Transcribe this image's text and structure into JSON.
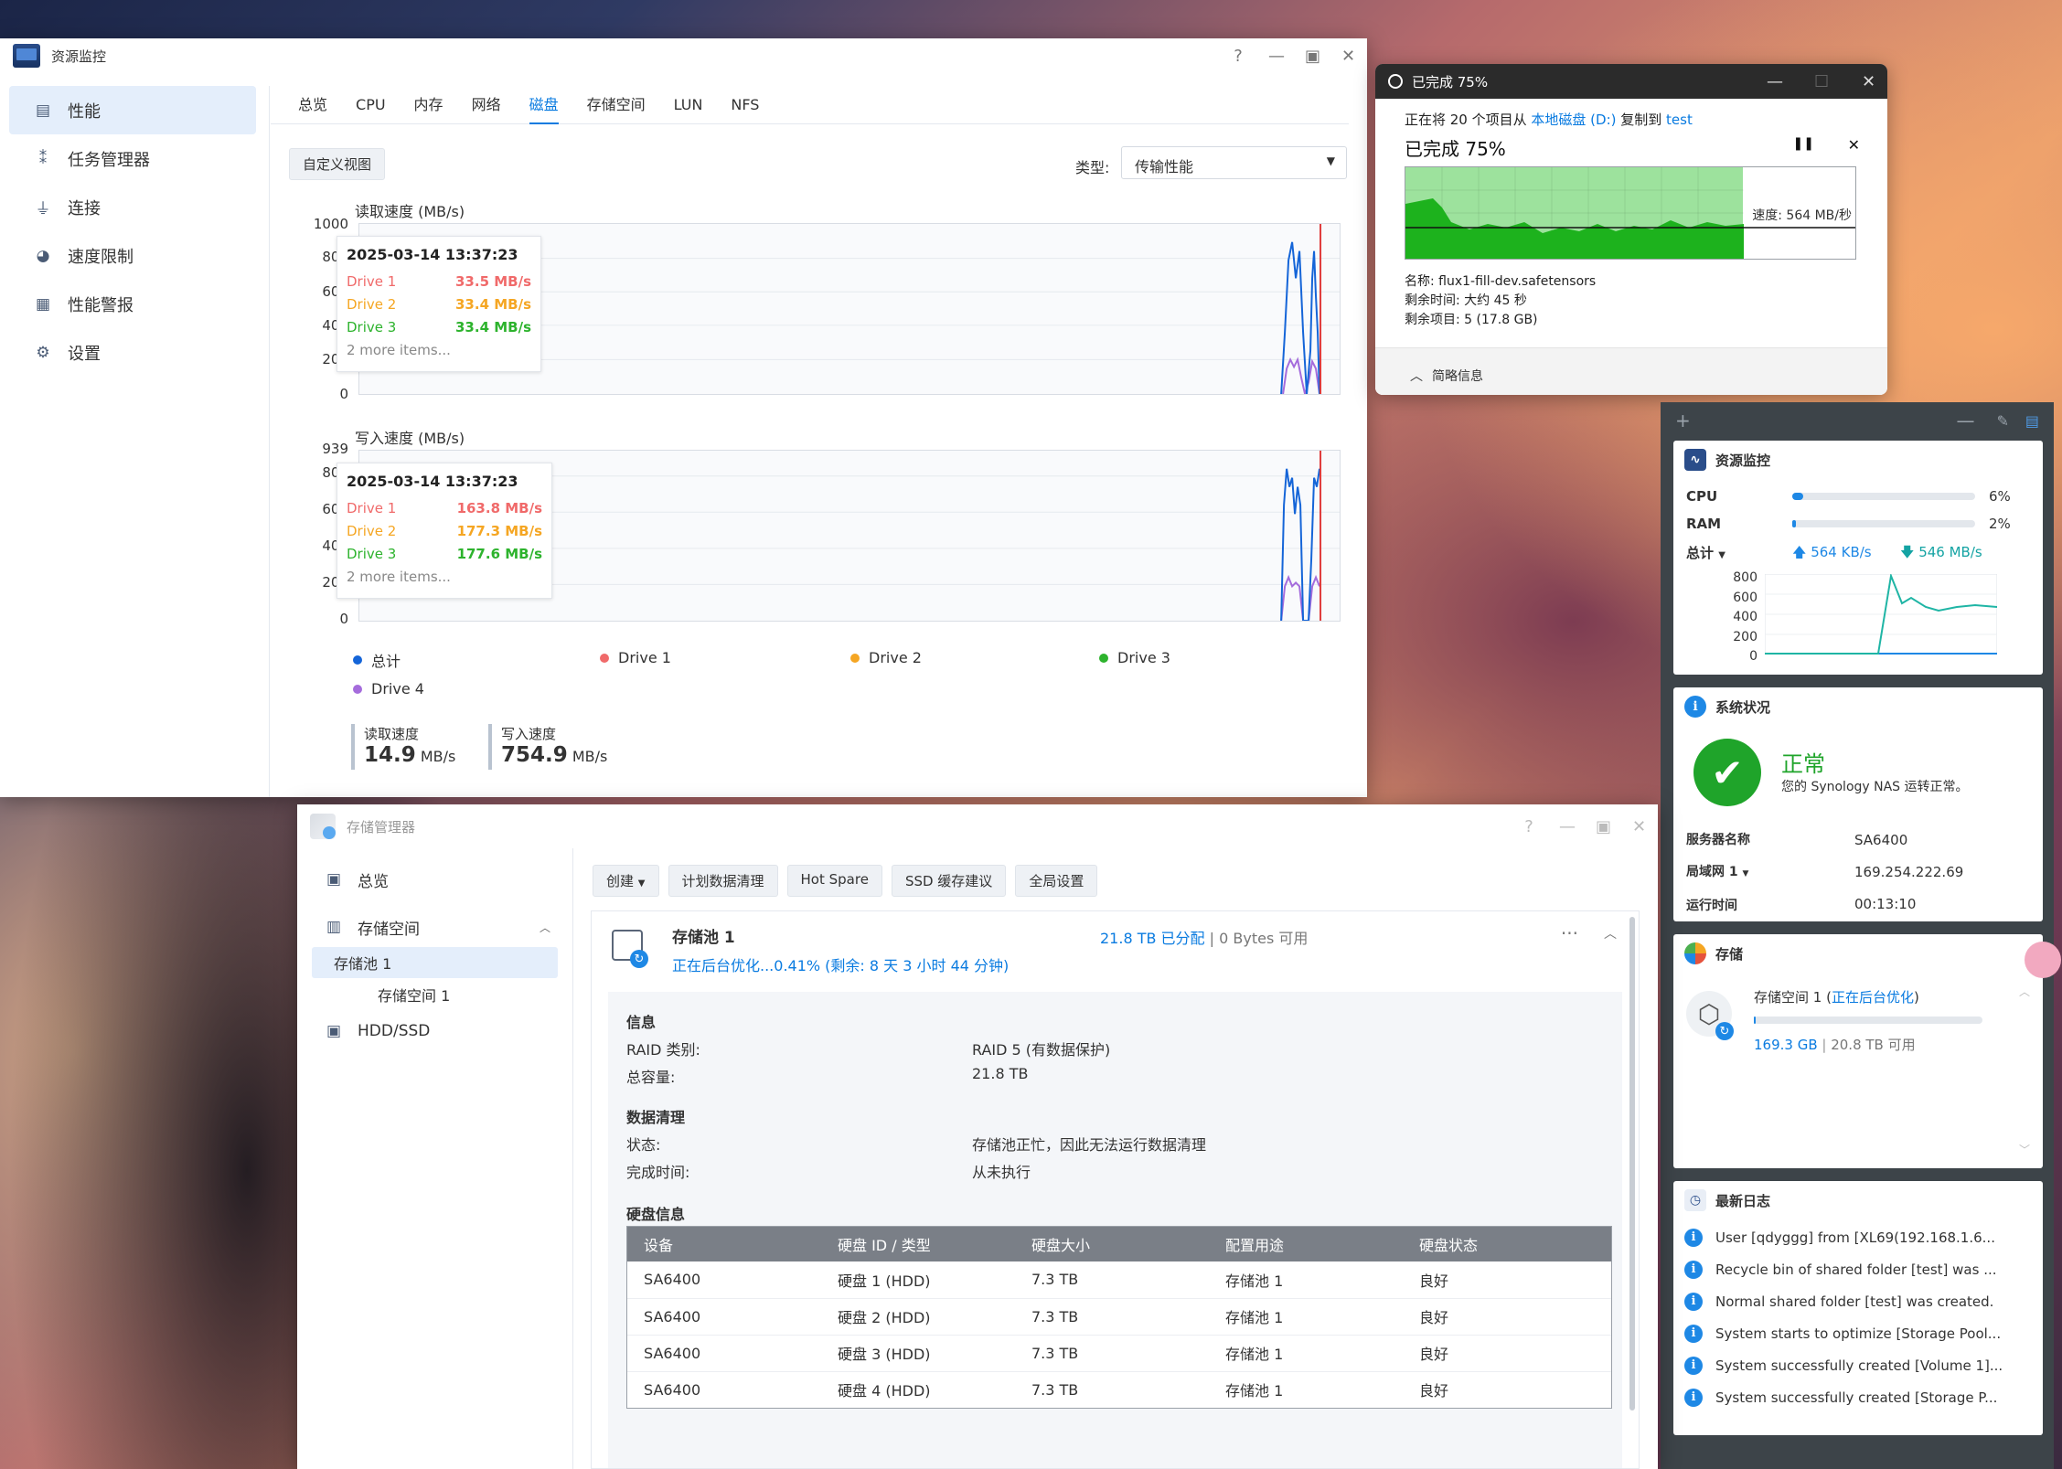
{
  "resource_monitor": {
    "title": "资源监控",
    "sidebar": [
      {
        "label": "性能",
        "icon": "performance-icon"
      },
      {
        "label": "任务管理器",
        "icon": "task-manager-icon"
      },
      {
        "label": "连接",
        "icon": "plug-icon"
      },
      {
        "label": "速度限制",
        "icon": "speed-limit-icon"
      },
      {
        "label": "性能警报",
        "icon": "alert-icon"
      },
      {
        "label": "设置",
        "icon": "gear-icon"
      }
    ],
    "tabs": [
      "总览",
      "CPU",
      "内存",
      "网络",
      "磁盘",
      "存储空间",
      "LUN",
      "NFS"
    ],
    "active_tab": "磁盘",
    "custom_view_label": "自定义视图",
    "type_label": "类型:",
    "type_value": "传输性能",
    "read_chart": {
      "title": "读取速度 (MB/s)",
      "y_ticks": [
        "1000",
        "800",
        "600",
        "400",
        "200",
        "0"
      ],
      "tooltip": {
        "timestamp": "2025-03-14 13:37:23",
        "rows": [
          {
            "name": "Drive 1",
            "value": "33.5 MB/s",
            "color": "#f06a6a"
          },
          {
            "name": "Drive 2",
            "value": "33.4 MB/s",
            "color": "#f5a623"
          },
          {
            "name": "Drive 3",
            "value": "33.4 MB/s",
            "color": "#2db32d"
          }
        ],
        "more": "2 more items..."
      }
    },
    "write_chart": {
      "title": "写入速度 (MB/s)",
      "y_ticks": [
        "939",
        "800",
        "600",
        "400",
        "200",
        "0"
      ],
      "tooltip": {
        "timestamp": "2025-03-14 13:37:23",
        "rows": [
          {
            "name": "Drive 1",
            "value": "163.8 MB/s",
            "color": "#f06a6a"
          },
          {
            "name": "Drive 2",
            "value": "177.3 MB/s",
            "color": "#f5a623"
          },
          {
            "name": "Drive 3",
            "value": "177.6 MB/s",
            "color": "#2db32d"
          }
        ],
        "more": "2 more items..."
      }
    },
    "legend": [
      {
        "name": "总计",
        "color": "#1565d8"
      },
      {
        "name": "Drive 1",
        "color": "#f06a6a"
      },
      {
        "name": "Drive 2",
        "color": "#f5a623"
      },
      {
        "name": "Drive 3",
        "color": "#2db32d"
      },
      {
        "name": "Drive 4",
        "color": "#a56cdc"
      }
    ],
    "summary": {
      "read_label": "读取速度",
      "read_value": "14.9",
      "read_unit": "MB/s",
      "write_label": "写入速度",
      "write_value": "754.9",
      "write_unit": "MB/s"
    }
  },
  "copy_dialog": {
    "title": "已完成 75%",
    "line_prefix": "正在将 20 个项目从 ",
    "source": "本地磁盘 (D:)",
    "line_mid": " 复制到 ",
    "dest": "test",
    "heading": "已完成 75%",
    "progress": 0.75,
    "speed": "速度: 564 MB/秒",
    "name_line": "名称: flux1-fill-dev.safetensors",
    "time_line": "剩余时间: 大约 45 秒",
    "items_line": "剩余项目: 5 (17.8 GB)",
    "details_toggle": "简略信息"
  },
  "widgets": {
    "monitor": {
      "title": "资源监控",
      "cpu_label": "CPU",
      "cpu_value": "6%",
      "cpu_pct": 6,
      "ram_label": "RAM",
      "ram_value": "2%",
      "ram_pct": 2,
      "total_label": "总计",
      "upload": "564 KB/s",
      "download": "546 MB/s",
      "y_ticks": [
        "800",
        "600",
        "400",
        "200",
        "0"
      ]
    },
    "health": {
      "title": "系统状况",
      "status": "正常",
      "desc": "您的 Synology NAS 运转正常。",
      "server_label": "服务器名称",
      "server_value": "SA6400",
      "lan_label": "局域网 1",
      "lan_value": "169.254.222.69",
      "uptime_label": "运行时间",
      "uptime_value": "00:13:10"
    },
    "storage": {
      "title": "存储",
      "volume_name": "存储空间 1 (",
      "volume_status": "正在后台优化",
      "volume_close": ")",
      "used": "169.3 GB",
      "sep": " | ",
      "total": "20.8 TB 可用",
      "used_pct": 0.8
    },
    "logs": {
      "title": "最新日志",
      "items": [
        "User [qdyggg] from [XL69(192.168.1.6...",
        "Recycle bin of shared folder [test] was ...",
        "Normal shared folder [test] was created.",
        "System starts to optimize [Storage Pool...",
        "System successfully created [Volume 1]...",
        "System successfully created [Storage P..."
      ]
    }
  },
  "storage_manager": {
    "title": "存储管理器",
    "sidebar": {
      "overview": "总览",
      "storage": "存储空间",
      "pool": "存储池 1",
      "volume": "存储空间 1",
      "hdd": "HDD/SSD"
    },
    "toolbar": [
      "创建",
      "计划数据清理",
      "Hot Spare",
      "SSD 缓存建议",
      "全局设置"
    ],
    "pool": {
      "name": "存储池 1",
      "status": "正在后台优化...0.41% (剩余: 8 天 3 小时 44 分钟)",
      "allocated": "21.8 TB 已分配",
      "available": " | 0 Bytes 可用"
    },
    "info_title": "信息",
    "raid_label": "RAID 类别:",
    "raid_value": "RAID 5 (有数据保护)",
    "capacity_label": "总容量:",
    "capacity_value": "21.8 TB",
    "scrub_title": "数据清理",
    "state_label": "状态:",
    "state_value": "存储池正忙，因此无法运行数据清理",
    "done_label": "完成时间:",
    "done_value": "从未执行",
    "disk_title": "硬盘信息",
    "columns": [
      "设备",
      "硬盘 ID / 类型",
      "硬盘大小",
      "配置用途",
      "硬盘状态"
    ],
    "rows": [
      [
        "SA6400",
        "硬盘 1 (HDD)",
        "7.3 TB",
        "存储池 1",
        "良好"
      ],
      [
        "SA6400",
        "硬盘 2 (HDD)",
        "7.3 TB",
        "存储池 1",
        "良好"
      ],
      [
        "SA6400",
        "硬盘 3 (HDD)",
        "7.3 TB",
        "存储池 1",
        "良好"
      ],
      [
        "SA6400",
        "硬盘 4 (HDD)",
        "7.3 TB",
        "存储池 1",
        "良好"
      ]
    ]
  },
  "colors": {
    "accent": "#0a7be0",
    "ok_green": "#22a322",
    "copy_green": "#1db21d"
  }
}
